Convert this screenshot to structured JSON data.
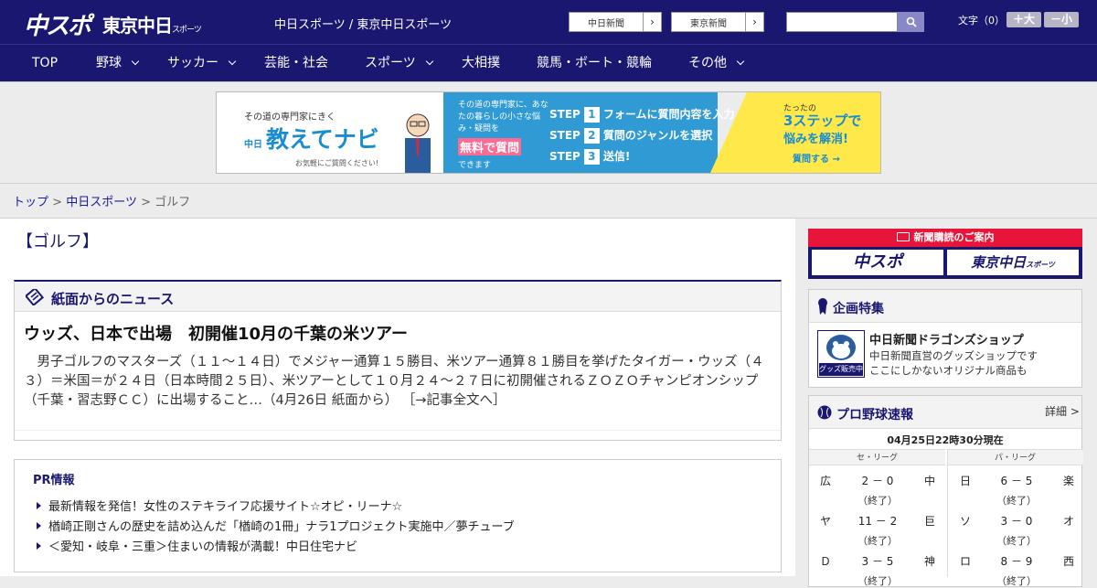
{
  "header": {
    "logo_chuspo": "中スポ",
    "logo_tokyo": "東京中日",
    "logo_tokyo_suffix": "スポーツ",
    "site_title": "中日スポーツ / 東京中日スポーツ",
    "paper_links": [
      "中日新聞",
      "東京新聞"
    ],
    "search_placeholder": "",
    "text_size_label": "文字（0）",
    "size_up": "＋大",
    "size_down": "－小"
  },
  "nav": {
    "items": [
      {
        "label": "TOP",
        "dropdown": false
      },
      {
        "label": "野球",
        "dropdown": true
      },
      {
        "label": "サッカー",
        "dropdown": true
      },
      {
        "label": "芸能・社会",
        "dropdown": false
      },
      {
        "label": "スポーツ",
        "dropdown": true
      },
      {
        "label": "大相撲",
        "dropdown": false
      },
      {
        "label": "競馬・ボート・競輪",
        "dropdown": false
      },
      {
        "label": "その他",
        "dropdown": true
      }
    ]
  },
  "banner": {
    "tagline": "その道の専門家にきく",
    "brand_small": "中日",
    "title": "教えてナビ",
    "sub": "お気軽にご質問ください!",
    "mid_text": "その道の専門家に、あなたの暮らしの小さな悩み・疑問を",
    "free": "無料で質問",
    "mid_text2": "できます",
    "steps": [
      {
        "n": "1",
        "text": "フォームに質問内容を入力"
      },
      {
        "n": "2",
        "text": "質問のジャンルを選択"
      },
      {
        "n": "3",
        "text": "送信!"
      }
    ],
    "step_word": "STEP",
    "right1": "たったの",
    "right2": "3ステップで",
    "right3": "悩みを解消!",
    "right4": "質問する →"
  },
  "breadcrumb": {
    "top": "トップ",
    "sep": ">",
    "chunichi": "中日スポーツ",
    "current": "ゴルフ"
  },
  "page_title": "【ゴルフ】",
  "news": {
    "section_title": "紙面からのニュース",
    "article_title": "ウッズ、日本で出場　初開催10月の千葉の米ツアー",
    "article_body": "　男子ゴルフのマスターズ（１１～１４日）でメジャー通算１５勝目、米ツアー通算８１勝目を挙げたタイガー・ウッズ（４３）＝米国＝が２４日（日本時間２５日）、米ツアーとして１０月２４～２７日に初開催されるＺＯＺＯチャンピオンシップ（千葉・習志野ＣＣ）に出場すること…（4月26日 紙面から）",
    "read_more": "［→記事全文へ］"
  },
  "pr": {
    "title": "PR情報",
    "items": [
      "最新情報を発信！女性のステキライフ応援サイト☆オピ・リーナ☆",
      "楢崎正剛さんの歴史を詰め込んだ「楢崎の1冊」ナラ1プロジェクト実施中／夢チューブ",
      "＜愛知・岐阜・三重＞住まいの情報が満載！中日住宅ナビ"
    ]
  },
  "sidebar": {
    "subscribe_head": "新聞購読のご案内",
    "subscribe_logos": [
      "中スポ",
      "東京中日"
    ],
    "subscribe_suffix": "スポーツ",
    "feature_title": "企画特集",
    "feature_item_title": "中日新聞ドラゴンズショップ",
    "feature_item_desc1": "中日新聞直営のグッズショップです",
    "feature_item_desc2": "ここにしかないオリジナル商品も",
    "feature_img_label": "グッズ販売中",
    "baseball_title": "プロ野球速報",
    "baseball_detail": "詳細 >",
    "baseball_date": "04月25日22時30分現在",
    "leagues": [
      "セ・リーグ",
      "パ・リーグ"
    ],
    "games_central": [
      {
        "home": "広",
        "score": "2 － 0",
        "away": "中",
        "status": "（終了）"
      },
      {
        "home": "ヤ",
        "score": "11 － 2",
        "away": "巨",
        "status": "（終了）"
      },
      {
        "home": "Ｄ",
        "score": "3 － 5",
        "away": "神",
        "status": "（終了）"
      }
    ],
    "games_pacific": [
      {
        "home": "日",
        "score": "6 － 5",
        "away": "楽",
        "status": "（終了）"
      },
      {
        "home": "ソ",
        "score": "3 － 0",
        "away": "オ",
        "status": "（終了）"
      },
      {
        "home": "ロ",
        "score": "8 － 9",
        "away": "西",
        "status": "（終了）"
      }
    ]
  },
  "colors": {
    "brand_navy": "#1a1770",
    "subscribe_red": "#e8153a",
    "banner_blue": "#2f9ad4",
    "banner_yellow": "#ffe84a"
  }
}
